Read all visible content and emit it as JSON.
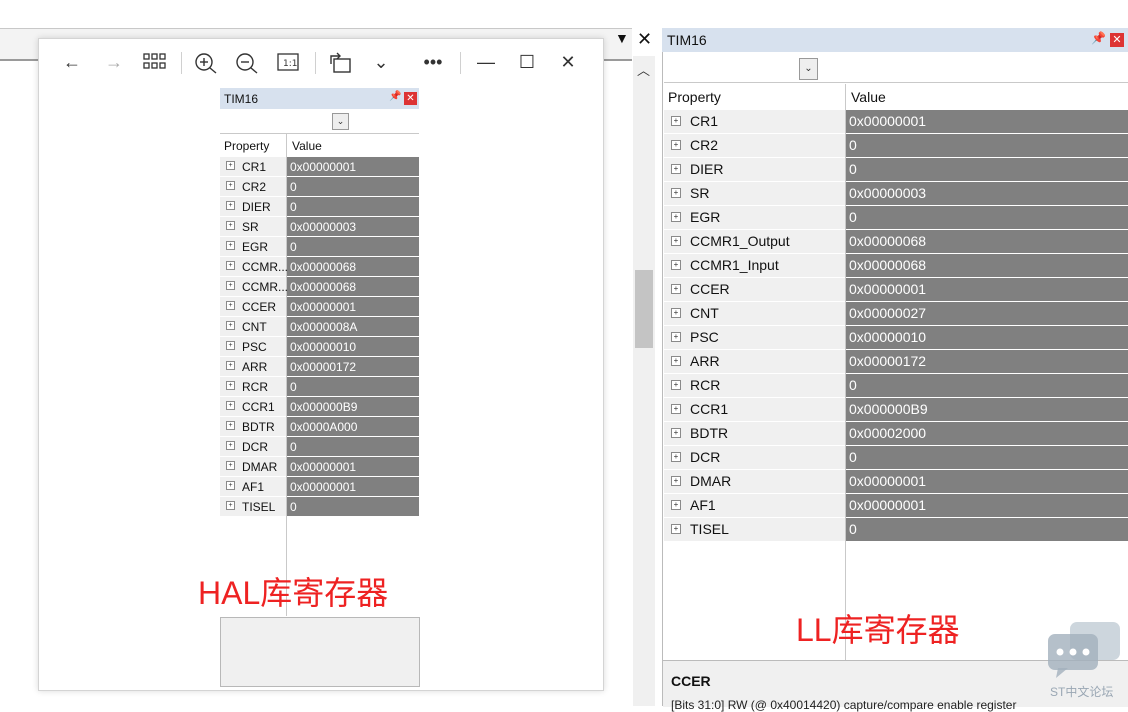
{
  "viewer": {
    "icons": [
      "back-arrow-icon",
      "forward-arrow-icon",
      "grid-icon",
      "zoom-in-icon",
      "zoom-out-icon",
      "actual-size-icon",
      "rotate-icon",
      "chevron-down-icon",
      "more-icon",
      "minimize-icon",
      "maximize-icon",
      "close-icon"
    ]
  },
  "hal_panel": {
    "title": "TIM16",
    "header_property": "Property",
    "header_value": "Value",
    "rows": [
      {
        "name": "CR1",
        "value": "0x00000001"
      },
      {
        "name": "CR2",
        "value": "0"
      },
      {
        "name": "DIER",
        "value": "0"
      },
      {
        "name": "SR",
        "value": "0x00000003"
      },
      {
        "name": "EGR",
        "value": "0"
      },
      {
        "name": "CCMR...",
        "value": "0x00000068"
      },
      {
        "name": "CCMR...",
        "value": "0x00000068"
      },
      {
        "name": "CCER",
        "value": "0x00000001"
      },
      {
        "name": "CNT",
        "value": "0x0000008A"
      },
      {
        "name": "PSC",
        "value": "0x00000010"
      },
      {
        "name": "ARR",
        "value": "0x00000172"
      },
      {
        "name": "RCR",
        "value": "0"
      },
      {
        "name": "CCR1",
        "value": "0x000000B9"
      },
      {
        "name": "BDTR",
        "value": "0x0000A000"
      },
      {
        "name": "DCR",
        "value": "0"
      },
      {
        "name": "DMAR",
        "value": "0x00000001"
      },
      {
        "name": "AF1",
        "value": "0x00000001"
      },
      {
        "name": "TISEL",
        "value": "0"
      }
    ],
    "annotation": "HAL库寄存器"
  },
  "ll_panel": {
    "title": "TIM16",
    "header_property": "Property",
    "header_value": "Value",
    "rows": [
      {
        "name": "CR1",
        "value": "0x00000001"
      },
      {
        "name": "CR2",
        "value": "0"
      },
      {
        "name": "DIER",
        "value": "0"
      },
      {
        "name": "SR",
        "value": "0x00000003"
      },
      {
        "name": "EGR",
        "value": "0"
      },
      {
        "name": "CCMR1_Output",
        "value": "0x00000068"
      },
      {
        "name": "CCMR1_Input",
        "value": "0x00000068"
      },
      {
        "name": "CCER",
        "value": "0x00000001"
      },
      {
        "name": "CNT",
        "value": "0x00000027"
      },
      {
        "name": "PSC",
        "value": "0x00000010"
      },
      {
        "name": "ARR",
        "value": "0x00000172"
      },
      {
        "name": "RCR",
        "value": "0"
      },
      {
        "name": "CCR1",
        "value": "0x000000B9"
      },
      {
        "name": "BDTR",
        "value": "0x00002000"
      },
      {
        "name": "DCR",
        "value": "0"
      },
      {
        "name": "DMAR",
        "value": "0x00000001"
      },
      {
        "name": "AF1",
        "value": "0x00000001"
      },
      {
        "name": "TISEL",
        "value": "0"
      }
    ],
    "annotation": "LL库寄存器",
    "description_title": "CCER",
    "description_text": "[Bits 31:0] RW (@ 0x40014420) capture/compare enable register"
  },
  "watermark": "ST中文论坛",
  "colors": {
    "value_cell": "#808080",
    "property_cell": "#f0f0f0",
    "title_bar": "#d7e1ee",
    "annotation": "#ee2222"
  }
}
